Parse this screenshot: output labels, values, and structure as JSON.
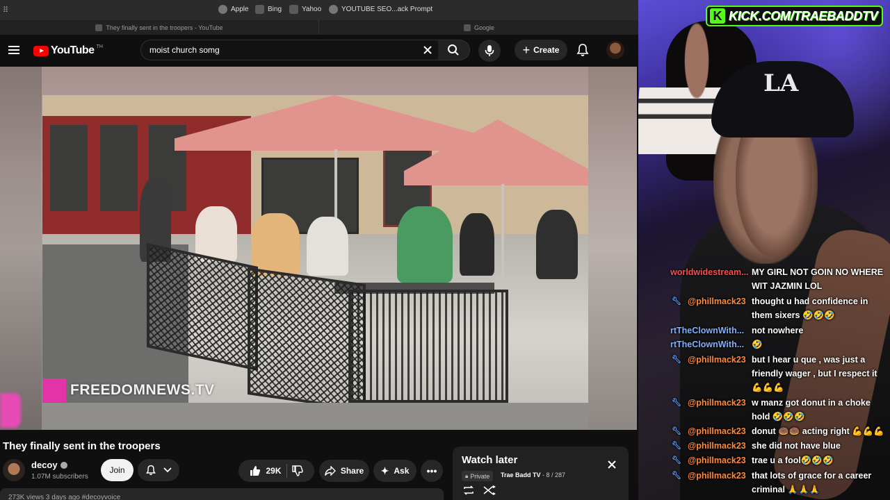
{
  "bookmarks": [
    "Apple",
    "Bing",
    "Yahoo",
    "YOUTUBE SEO...ack Prompt"
  ],
  "tabs": [
    "They finally sent in the troopers - YouTube",
    "Google"
  ],
  "header": {
    "logo": "YouTube",
    "logo_country": "TH",
    "search_value": "moist church somg",
    "create_label": "Create"
  },
  "video": {
    "watermark": "FREEDOMNEWS.TV",
    "title": "They finally sent in the troopers",
    "channel": "decoy",
    "subscribers": "1.07M subscribers",
    "join_label": "Join",
    "likes": "29K",
    "share_label": "Share",
    "ask_label": "Ask",
    "description_peek": "273K views  3 days ago  #decoyvoice"
  },
  "watch_later": {
    "title": "Watch later",
    "privacy": "Private",
    "owner": "Trae Badd TV",
    "position": "8 / 287"
  },
  "stream": {
    "kick_url": "KICK.COM/TRAEBADDTV",
    "kick_letter": "K"
  },
  "chat": [
    {
      "user": "worldwidestream...",
      "text": "MY GIRL NOT GOIN NO WHERE WIT JAZMIN LOL",
      "color": "#ff4b4b"
    },
    {
      "user": "@phillmack23",
      "text": "thought u had confidence in them sixers 🤣🤣🤣",
      "color": "#ff8a3c"
    },
    {
      "user": "rtTheClownWith...",
      "text": "not nowhere",
      "color": "#7fb1ff"
    },
    {
      "user": "rtTheClownWith...",
      "text": "🤣",
      "color": "#7fb1ff"
    },
    {
      "user": "@phillmack23",
      "text": "but I hear u que , was just a friendly wager , but I respect it 💪💪💪",
      "color": "#ff8a3c"
    },
    {
      "user": "@phillmack23",
      "text": "w manz got donut in a choke hold 🤣🤣🤣",
      "color": "#ff8a3c"
    },
    {
      "user": "@phillmack23",
      "text": "donut 🍩🍩 acting right 💪💪💪",
      "color": "#ff8a3c"
    },
    {
      "user": "@phillmack23",
      "text": "she did not have blue",
      "color": "#ff8a3c"
    },
    {
      "user": "@phillmack23",
      "text": "trae u a fool🤣🤣🤣",
      "color": "#ff8a3c"
    },
    {
      "user": "@phillmack23",
      "text": "that lots of grace for a career criminal 🙏🙏🙏",
      "color": "#ff8a3c"
    }
  ]
}
